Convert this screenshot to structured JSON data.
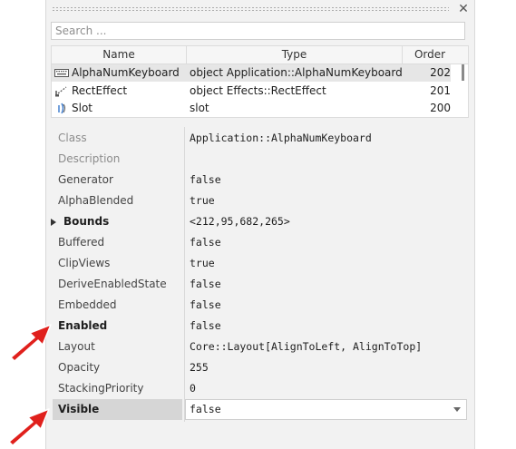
{
  "search": {
    "placeholder": "Search ..."
  },
  "list": {
    "columns": {
      "name": "Name",
      "type": "Type",
      "order": "Order"
    },
    "rows": [
      {
        "name": "AlphaNumKeyboard",
        "type": "object Application::AlphaNumKeyboard",
        "order": "202",
        "icon": "keyboard-icon"
      },
      {
        "name": "RectEffect",
        "type": "object Effects::RectEffect",
        "order": "201",
        "icon": "rect-effect-icon"
      },
      {
        "name": "Slot",
        "type": "slot",
        "order": "200",
        "icon": "slot-icon"
      }
    ]
  },
  "properties": [
    {
      "name": "Class",
      "value": "Application::AlphaNumKeyboard"
    },
    {
      "name": "Description",
      "value": ""
    },
    {
      "name": "Generator",
      "value": "false"
    },
    {
      "name": "AlphaBlended",
      "value": "true"
    },
    {
      "name": "Bounds",
      "value": "<212,95,682,265>"
    },
    {
      "name": "Buffered",
      "value": "false"
    },
    {
      "name": "ClipViews",
      "value": "true"
    },
    {
      "name": "DeriveEnabledState",
      "value": "false"
    },
    {
      "name": "Embedded",
      "value": "false"
    },
    {
      "name": "Enabled",
      "value": "false"
    },
    {
      "name": "Layout",
      "value": "Core::Layout[AlignToLeft, AlignToTop]"
    },
    {
      "name": "Opacity",
      "value": "255"
    },
    {
      "name": "StackingPriority",
      "value": "0"
    },
    {
      "name": "Visible",
      "value": "false"
    }
  ],
  "colors": {
    "arrow": "#e0201c",
    "selection": "#d6d6d6"
  }
}
